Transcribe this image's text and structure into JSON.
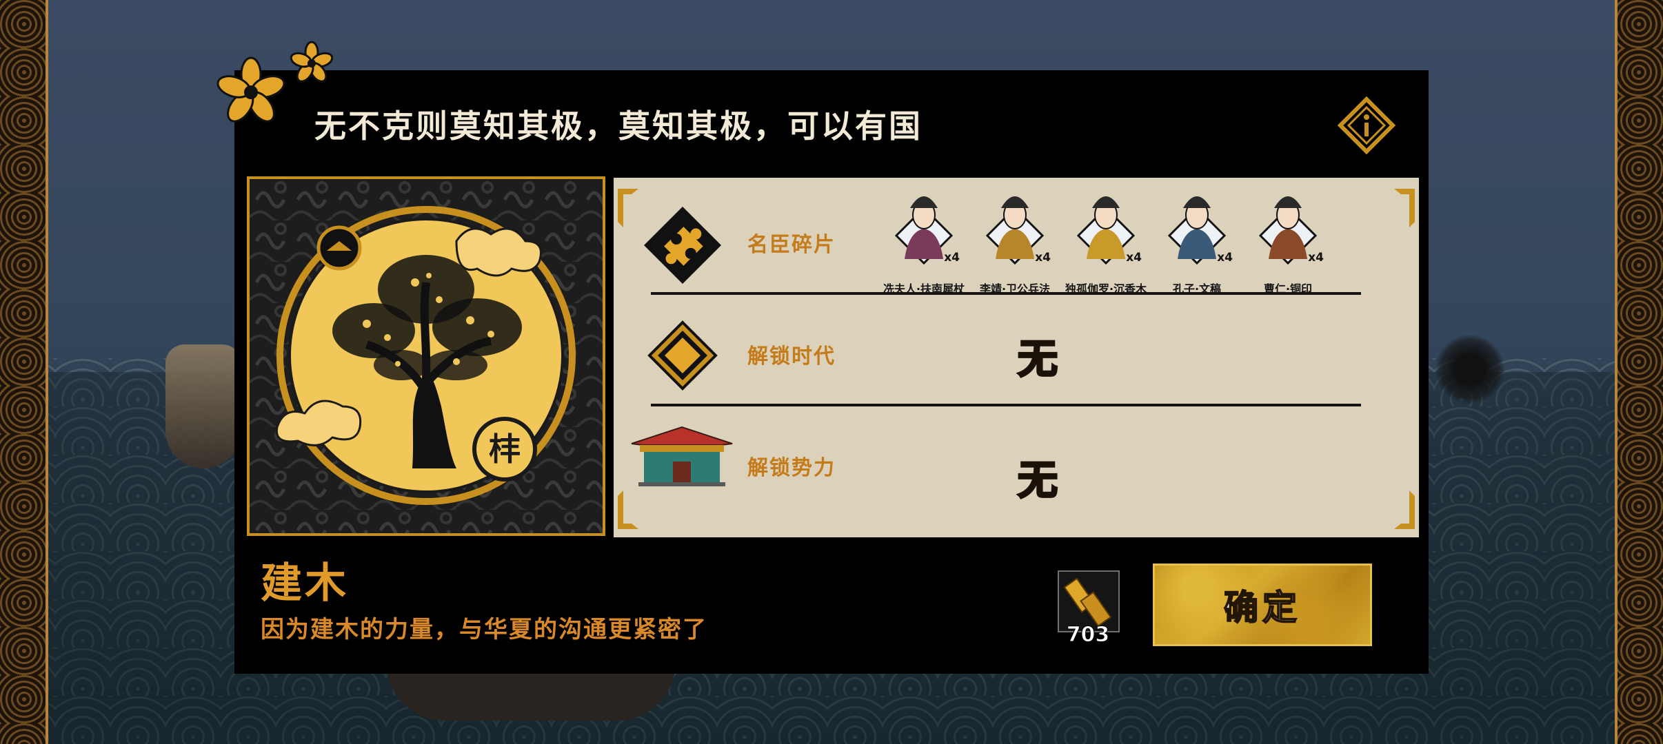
{
  "dialog": {
    "title": "无不克则莫知其极，莫知其极，可以有国",
    "info_icon": "info-icon"
  },
  "art": {
    "icon": "golden-tree-emblem",
    "badge_glyph": "㭋"
  },
  "rows": {
    "fragments": {
      "label": "名臣碎片",
      "icon": "puzzle-piece-icon",
      "heroes": [
        {
          "name": "冼夫人·扶南犀杖",
          "count": "x4",
          "color": "#7a3a5a"
        },
        {
          "name": "李靖·卫公兵法",
          "count": "x4",
          "color": "#b8862a"
        },
        {
          "name": "独孤伽罗·沉香木",
          "count": "x4",
          "color": "#c89a2a"
        },
        {
          "name": "孔子·文稿",
          "count": "x4",
          "color": "#3a5a7a"
        },
        {
          "name": "曹仁·铜印",
          "count": "x4",
          "color": "#8a4a2a"
        }
      ]
    },
    "era": {
      "label": "解锁时代",
      "icon": "era-medallion-icon",
      "value": "无"
    },
    "faction": {
      "label": "解锁势力",
      "icon": "palace-icon",
      "value": "无"
    }
  },
  "item": {
    "name": "建木",
    "description": "因为建木的力量，与华夏的沟通更紧密了"
  },
  "currency": {
    "icon": "gold-bars-icon",
    "amount": "703"
  },
  "confirm": {
    "label": "确定"
  },
  "colors": {
    "accent_gold": "#e0a22a",
    "panel_bg": "#dcd2bc",
    "dialog_bg": "#000000"
  }
}
